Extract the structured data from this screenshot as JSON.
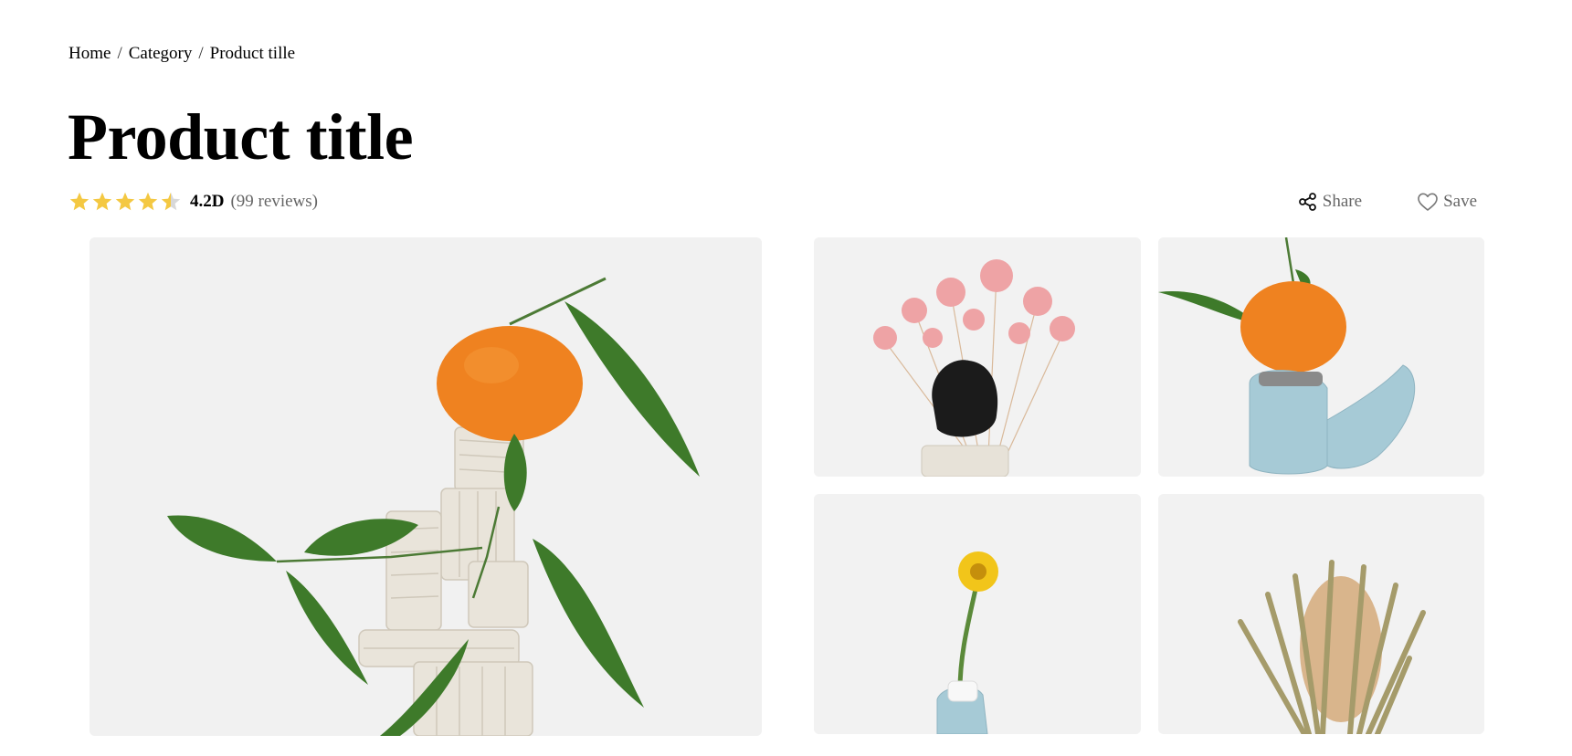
{
  "breadcrumb": {
    "home": "Home",
    "separator": "/",
    "category": "Category",
    "current": "Product tille"
  },
  "product": {
    "title": "Product title",
    "rating": {
      "stars": 4.5,
      "max": 5,
      "value_label": "4.2D",
      "reviews_label": "(99 reviews)"
    }
  },
  "actions": {
    "share_label": "Share",
    "save_label": "Save",
    "share_icon": "share-icon",
    "save_icon": "heart-icon"
  },
  "gallery": [
    {
      "name": "gallery-image-main",
      "subject": "orange on stacked clay coil sculpture with leaves"
    },
    {
      "name": "gallery-image-thumb-1",
      "subject": "pink dried gypsophila with black rock"
    },
    {
      "name": "gallery-image-thumb-2",
      "subject": "orange on light blue coil vase"
    },
    {
      "name": "gallery-image-thumb-3",
      "subject": "yellow flower in blue vase"
    },
    {
      "name": "gallery-image-thumb-4",
      "subject": "dried banksia flower"
    }
  ],
  "colors": {
    "star": "#f4c842",
    "star_empty": "#d8d8d8",
    "muted_text": "#666666",
    "image_bg": "#f2f2f2"
  }
}
